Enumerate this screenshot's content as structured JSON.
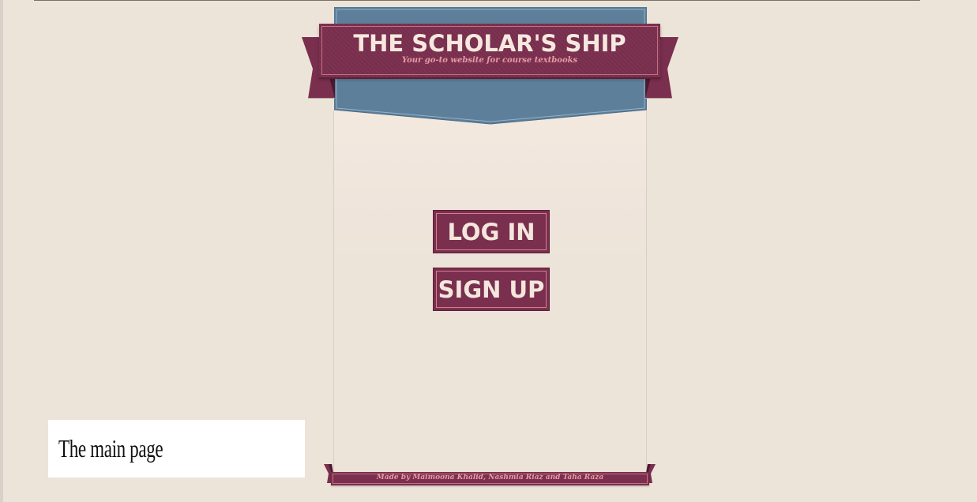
{
  "header": {
    "title": "THE SCHOLAR'S SHIP",
    "tagline": "Your go-to website for course textbooks"
  },
  "actions": {
    "login_label": "LOG IN",
    "signup_label": "SIGN UP"
  },
  "footer": {
    "credits": "Made by Maimoona Khalid, Nashmia Riaz and Taha Raza"
  },
  "caption": {
    "text": "The main page"
  },
  "colors": {
    "background": "#ece3d9",
    "ribbon": "#7a2f4e",
    "banner_blue": "#5e7f9a",
    "text_light": "#f6e8df",
    "accent_pink": "#e89aa6"
  }
}
